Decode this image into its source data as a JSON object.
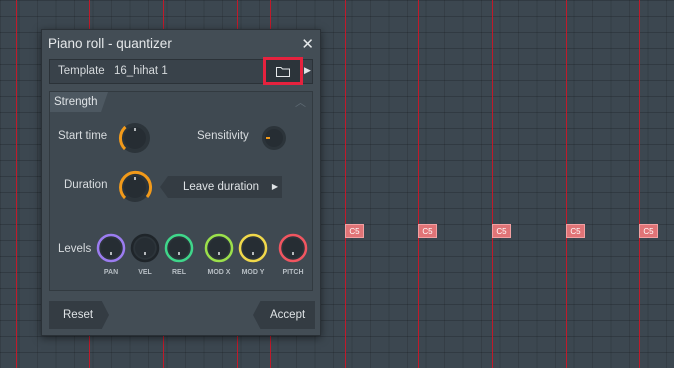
{
  "window": {
    "title": "Piano roll - quantizer",
    "close_glyph": "✕"
  },
  "template": {
    "label": "Template",
    "value": "16_hihat 1",
    "browse_icon": "folder-icon",
    "next_glyph": "▶"
  },
  "strength": {
    "tab_label": "Strength",
    "collapse_glyph": "︿",
    "start_time_label": "Start time",
    "sensitivity_label": "Sensitivity",
    "duration_label": "Duration",
    "duration_select": "Leave duration",
    "duration_arrow": "▶",
    "levels_label": "Levels",
    "level_knobs": [
      {
        "label": "PAN",
        "color": "#9b7cf0"
      },
      {
        "label": "VEL",
        "color": "#2c343a"
      },
      {
        "label": "REL",
        "color": "#3fd68a"
      },
      {
        "label": "MOD X",
        "color": "#9be04b"
      },
      {
        "label": "MOD Y",
        "color": "#f0d84a"
      },
      {
        "label": "PITCH",
        "color": "#f05560"
      }
    ]
  },
  "buttons": {
    "reset": "Reset",
    "accept": "Accept"
  },
  "notes": {
    "label": "C5"
  },
  "colors": {
    "accent": "#f29a1a",
    "highlight": "#e6223e",
    "bar_line": "#c01a2a",
    "note": "#e07477"
  }
}
